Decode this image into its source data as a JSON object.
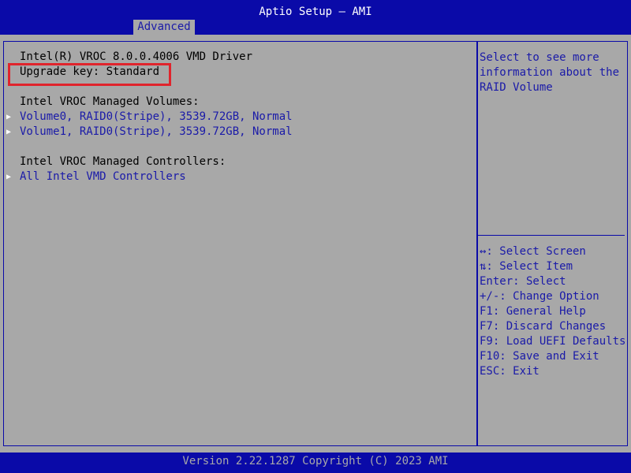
{
  "header": {
    "title": "Aptio Setup – AMI",
    "active_tab": "Advanced"
  },
  "main": {
    "driver_line": "Intel(R) VROC 8.0.0.4006 VMD Driver",
    "upgrade_key": "Upgrade key: Standard",
    "volumes_heading": "Intel VROC Managed Volumes:",
    "volumes": [
      "Volume0, RAID0(Stripe), 3539.72GB, Normal",
      "Volume1, RAID0(Stripe), 3539.72GB, Normal"
    ],
    "controllers_heading": "Intel VROC Managed Controllers:",
    "controllers": [
      "All Intel VMD Controllers"
    ]
  },
  "help": {
    "description": "Select to see more information about the RAID Volume",
    "keys": [
      "↔: Select Screen",
      "⇅: Select Item",
      "Enter: Select",
      "+/-: Change Option",
      "F1: General Help",
      "F7: Discard Changes",
      "F9: Load UEFI Defaults",
      "F10: Save and Exit",
      "ESC: Exit"
    ]
  },
  "footer": {
    "text": "Version 2.22.1287 Copyright (C) 2023 AMI"
  },
  "colors": {
    "background_blue": "#0a0aa8",
    "panel_gray": "#a8a8a8",
    "link_blue": "#1a1aa8",
    "highlight_red": "#e0242c"
  }
}
